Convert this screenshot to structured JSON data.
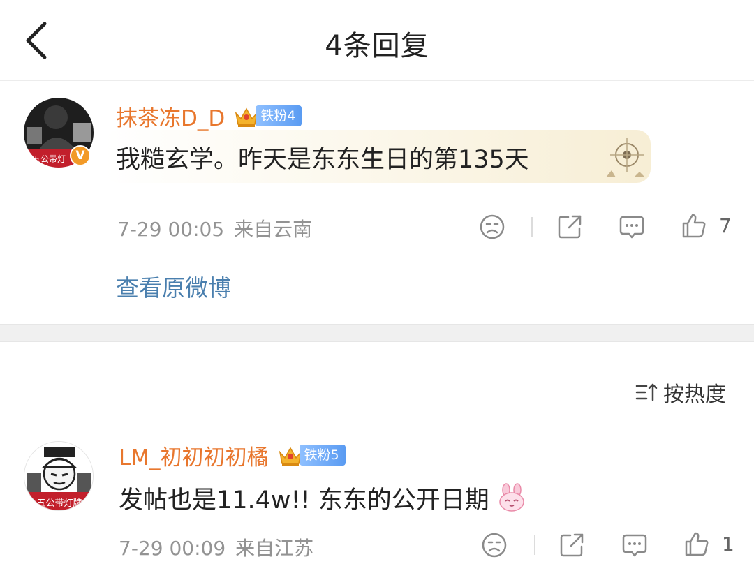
{
  "header": {
    "title": "4条回复"
  },
  "root_comment": {
    "username": "抹茶冻D_D",
    "avatar_text": "五公带灯",
    "verified_mark": "V",
    "fan_badge": "铁粉4",
    "text": "我糙玄学。昨天是东东生日的第135天",
    "time": "7-29 00:05",
    "source": "来自云南",
    "likes": "7",
    "view_original": "查看原微博"
  },
  "sort": {
    "label": "按热度"
  },
  "replies": [
    {
      "username": "LM_初初初初橘",
      "avatar_text": "五公带灯牌",
      "fan_badge": "铁粉5",
      "text": "发帖也是11.4w!! 东东的公开日期",
      "time": "7-29 00:09",
      "source": "来自江苏",
      "likes": "1"
    }
  ],
  "colors": {
    "username": "#e8772e",
    "link": "#4a7fae",
    "badge": "#5a9bf2",
    "meta": "#939393"
  },
  "icons": [
    "back-arrow-icon",
    "crown-icon",
    "sad-face-icon",
    "share-icon",
    "comment-icon",
    "thumbs-up-icon",
    "sort-icon",
    "bunny-emoji-icon"
  ]
}
